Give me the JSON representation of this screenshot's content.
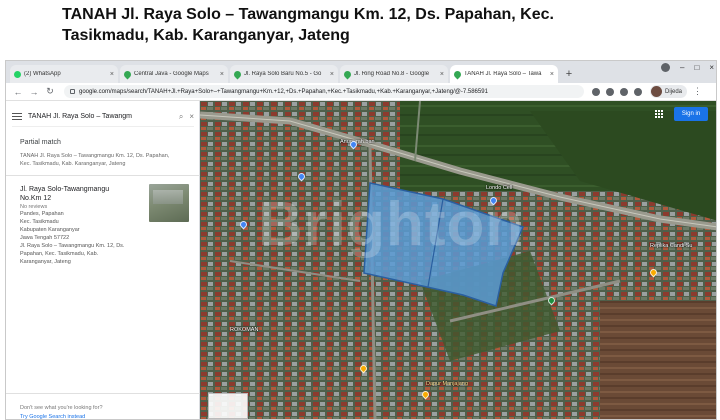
{
  "headline": {
    "line1": "TANAH Jl. Raya Solo – Tawangmangu Km. 12, Ds. Papahan, Kec.",
    "line2": "Tasikmadu, Kab. Karanganyar, Jateng"
  },
  "browser": {
    "tabs": [
      {
        "title": "(2) WhatsApp",
        "favicon": "whatsapp-icon",
        "active": false
      },
      {
        "title": "Central Java - Google Maps",
        "favicon": "maps-icon",
        "active": false
      },
      {
        "title": "Jl. Raya Solo Baru No.5 - Go",
        "favicon": "maps-icon",
        "active": false
      },
      {
        "title": "Jl. Ring Road No.8 - Google",
        "favicon": "maps-icon",
        "active": false
      },
      {
        "title": "TANAH Jl. Raya Solo – Tawa",
        "favicon": "maps-icon",
        "active": true
      }
    ],
    "new_tab": "+",
    "url": "google.com/maps/search/TANAH+Jl.+Raya+Solo+–+Tawangmangu+Km.+12,+Ds.+Papahan,+Kec.+Tasikmadu,+Kab.+Karanganyar,+Jateng/@-7.586591",
    "profile_name": "Dijeda"
  },
  "panel": {
    "search_query": "TANAH Jl. Raya Solo – Tawangm",
    "partial_match": "Partial match",
    "partial_detail_line1": "TANAH Jl. Raya Solo – Tawangmangu Km. 12, Ds. Papahan,",
    "partial_detail_line2": "Kec. Tasikmadu, Kab. Karanganyar, Jateng",
    "result": {
      "name_line1": "Jl. Raya Solo-Tawangmangu",
      "name_line2": "No.Km 12",
      "reviews": "No reviews",
      "addr": [
        "Pandes, Papahan",
        "Kec. Tasikmadu",
        "Kabupaten Karanganyar",
        "Jawa Tengah 57722",
        "Jl. Raya Solo – Tawangmangu Km. 12, Ds.",
        "Papahan, Kec. Tasikmadu, Kab.",
        "Karanganyar, Jateng"
      ]
    },
    "not_found": "Don't see what you're looking for?",
    "try_search": "Try Google Search instead"
  },
  "map": {
    "sign_in": "Sign in",
    "watermark": "Brighton",
    "labels": {
      "area_north": "Anugerah ban",
      "shop": "Londo Cell",
      "east": "Replika Candi Su",
      "south_west": "ROKOMAN",
      "south_mid": "Dapur Manjajang",
      "road": "Jl. Raya Solo – Tawangmangu"
    },
    "colors": {
      "parcel": "#5b9bd5",
      "fields": "#4a6b3a",
      "road": "#9a9a8e"
    }
  }
}
